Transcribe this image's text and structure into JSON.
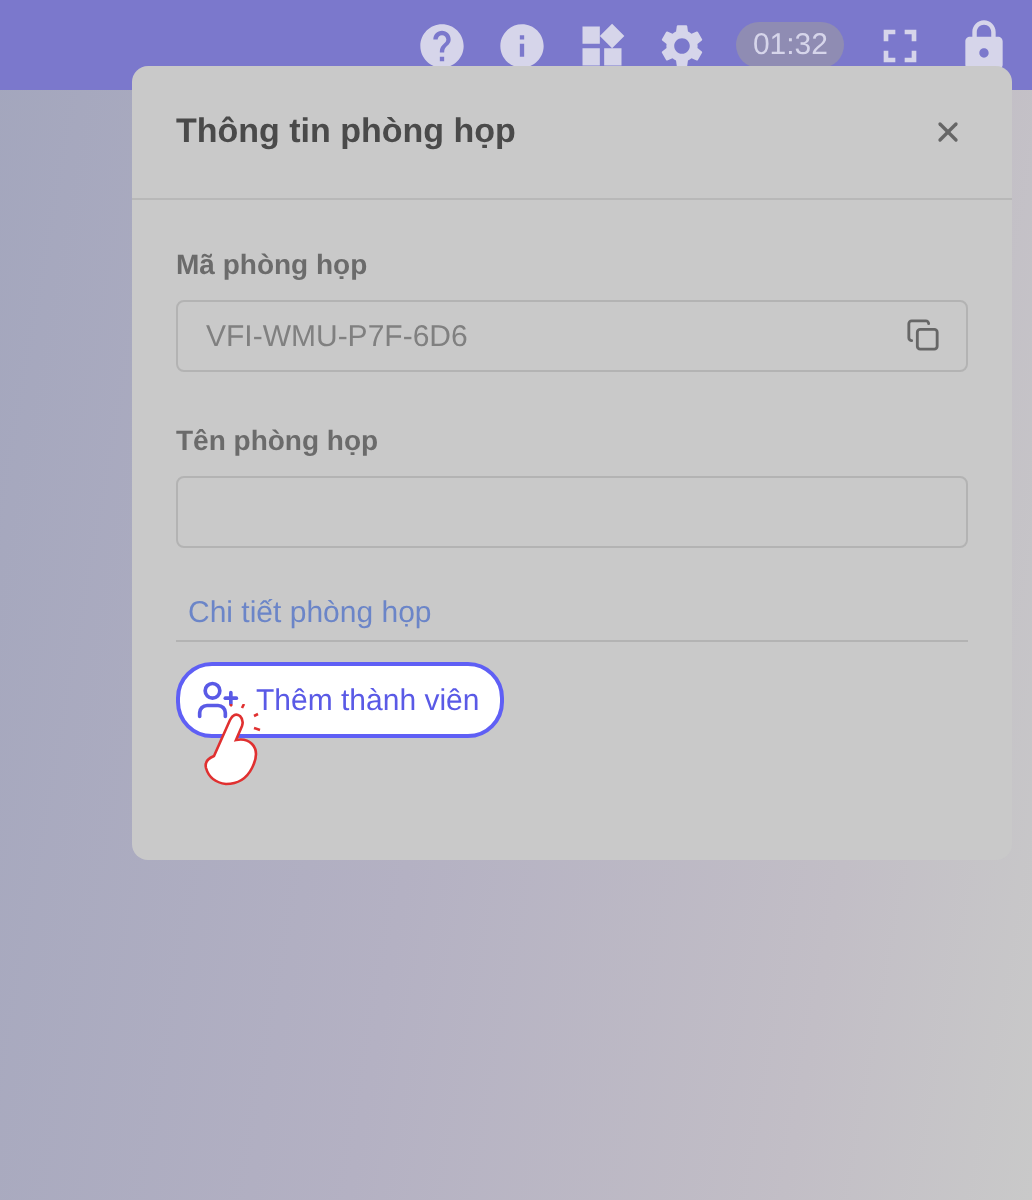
{
  "top_bar": {
    "timer": "01:32"
  },
  "dialog": {
    "title": "Thông tin phòng họp",
    "fields": [
      {
        "label": "Mã phòng họp",
        "value": "VFI-WMU-P7F-6D6",
        "copyable": true
      },
      {
        "label": "Tên phòng họp",
        "copyable": false
      }
    ],
    "details_link": "Chi tiết phòng họp",
    "add_member_button": "Thêm thành viên"
  }
}
